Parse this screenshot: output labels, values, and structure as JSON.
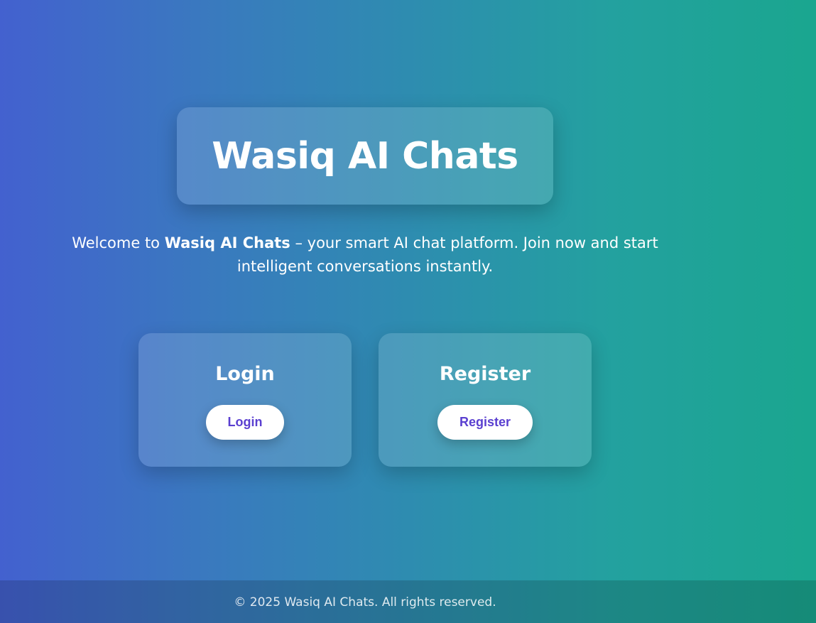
{
  "header": {
    "title": "Wasiq AI Chats"
  },
  "welcome": {
    "prefix": "Welcome to ",
    "brand": "Wasiq AI Chats",
    "suffix": " – your smart AI chat platform. Join now and start intelligent conversations instantly."
  },
  "cards": {
    "login": {
      "heading": "Login",
      "button_label": "Login"
    },
    "register": {
      "heading": "Register",
      "button_label": "Register"
    }
  },
  "footer": {
    "text": "© 2025 Wasiq AI Chats. All rights reserved."
  },
  "colors": {
    "gradient_start": "#4361cf",
    "gradient_end": "#1aa68f",
    "button_text": "#5a3fd0",
    "button_bg": "#ffffff"
  }
}
